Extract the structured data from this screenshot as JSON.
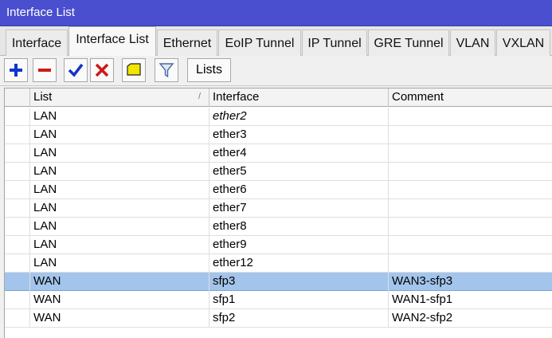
{
  "window": {
    "title": "Interface List"
  },
  "tabs": [
    {
      "label": "Interface",
      "active": false
    },
    {
      "label": "Interface List",
      "active": true
    },
    {
      "label": "Ethernet",
      "active": false
    },
    {
      "label": "EoIP Tunnel",
      "active": false
    },
    {
      "label": "IP Tunnel",
      "active": false
    },
    {
      "label": "GRE Tunnel",
      "active": false
    },
    {
      "label": "VLAN",
      "active": false
    },
    {
      "label": "VXLAN",
      "active": false
    }
  ],
  "toolbar": {
    "buttons": [
      {
        "name": "add-button",
        "icon": "plus-icon",
        "color": "#1434c8"
      },
      {
        "name": "remove-button",
        "icon": "minus-icon",
        "color": "#d01818"
      },
      {
        "name": "enable-button",
        "icon": "check-icon",
        "color": "#1434c8"
      },
      {
        "name": "disable-button",
        "icon": "x-icon",
        "color": "#d01818"
      },
      {
        "name": "comment-button",
        "icon": "note-icon",
        "color": "#f2e600"
      },
      {
        "name": "filter-button",
        "icon": "funnel-icon",
        "color": "#4a6aa0"
      }
    ],
    "lists_label": "Lists"
  },
  "table": {
    "columns": [
      "List",
      "Interface",
      "Comment"
    ],
    "sort_indicator": "/",
    "rows": [
      {
        "list": "LAN",
        "interface": "ether2",
        "comment": "",
        "italic": true,
        "selected": false
      },
      {
        "list": "LAN",
        "interface": "ether3",
        "comment": "",
        "italic": false,
        "selected": false
      },
      {
        "list": "LAN",
        "interface": "ether4",
        "comment": "",
        "italic": false,
        "selected": false
      },
      {
        "list": "LAN",
        "interface": "ether5",
        "comment": "",
        "italic": false,
        "selected": false
      },
      {
        "list": "LAN",
        "interface": "ether6",
        "comment": "",
        "italic": false,
        "selected": false
      },
      {
        "list": "LAN",
        "interface": "ether7",
        "comment": "",
        "italic": false,
        "selected": false
      },
      {
        "list": "LAN",
        "interface": "ether8",
        "comment": "",
        "italic": false,
        "selected": false
      },
      {
        "list": "LAN",
        "interface": "ether9",
        "comment": "",
        "italic": false,
        "selected": false
      },
      {
        "list": "LAN",
        "interface": "ether12",
        "comment": "",
        "italic": false,
        "selected": false
      },
      {
        "list": "WAN",
        "interface": "sfp3",
        "comment": "WAN3-sfp3",
        "italic": false,
        "selected": true
      },
      {
        "list": "WAN",
        "interface": "sfp1",
        "comment": "WAN1-sfp1",
        "italic": false,
        "selected": false
      },
      {
        "list": "WAN",
        "interface": "sfp2",
        "comment": "WAN2-sfp2",
        "italic": false,
        "selected": false
      }
    ]
  },
  "colors": {
    "titlebar": "#4a4fcf",
    "selected_row": "#a3c5eb"
  }
}
